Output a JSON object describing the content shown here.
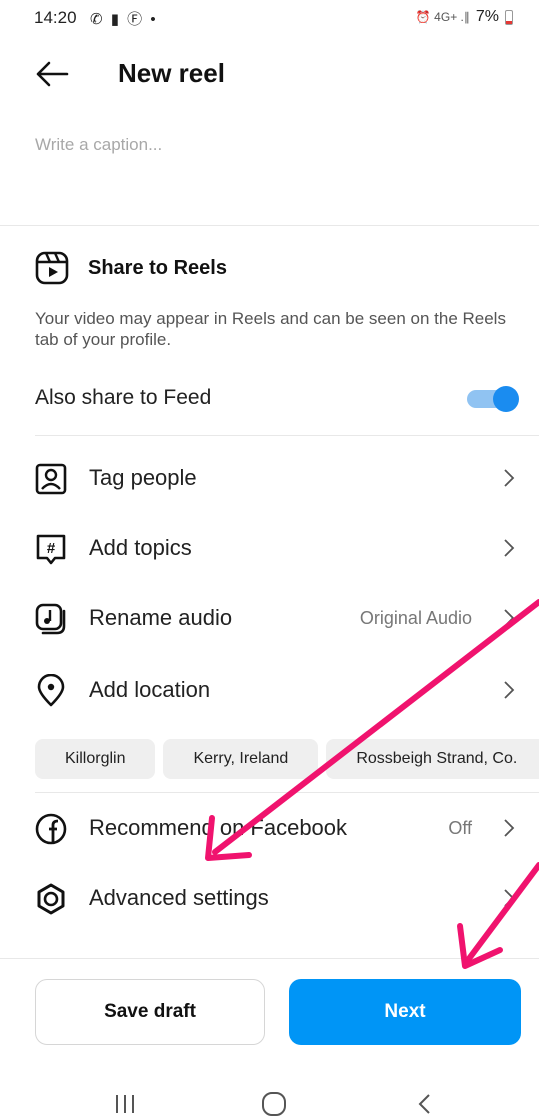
{
  "status_bar": {
    "time": "14:20",
    "left_icons": "✆ ▮ Ⓕ •",
    "network": "⏰ 4G+ .∥",
    "battery": "7%"
  },
  "header": {
    "title": "New reel"
  },
  "caption": {
    "placeholder": "Write a caption..."
  },
  "share_to_reels": {
    "title": "Share to Reels",
    "description": "Your video may appear in Reels and can be seen on the Reels tab of your profile.",
    "feed_label": "Also share to Feed",
    "feed_enabled": true
  },
  "options": [
    {
      "label": "Tag people",
      "value": ""
    },
    {
      "label": "Add topics",
      "value": ""
    },
    {
      "label": "Rename audio",
      "value": "Original Audio"
    },
    {
      "label": "Add location",
      "value": ""
    }
  ],
  "location_chips": [
    "Killorglin",
    "Kerry, Ireland",
    "Rossbeigh Strand, Co."
  ],
  "facebook": {
    "label": "Recommend on Facebook",
    "value": "Off"
  },
  "advanced": {
    "label": "Advanced settings"
  },
  "buttons": {
    "save_draft": "Save draft",
    "next": "Next"
  },
  "colors": {
    "primary_blue": "#0095f6",
    "toggle_blue": "#1a8cf0",
    "annotation_pink": "#f0136e"
  }
}
